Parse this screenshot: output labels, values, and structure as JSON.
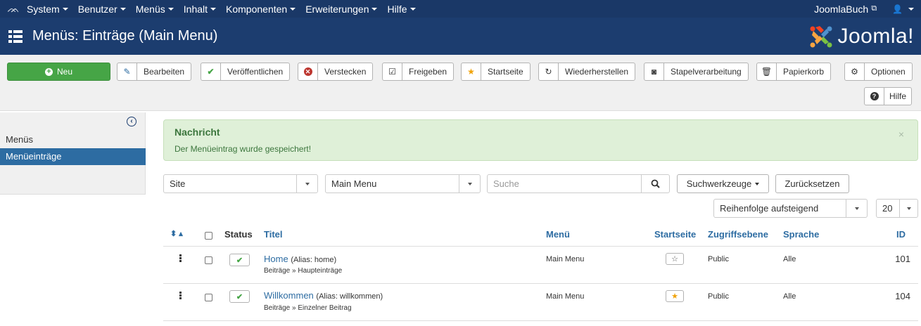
{
  "topnav": {
    "logo": "ᨏ",
    "menu": [
      {
        "label": "System"
      },
      {
        "label": "Benutzer"
      },
      {
        "label": "Menüs"
      },
      {
        "label": "Inhalt"
      },
      {
        "label": "Komponenten"
      },
      {
        "label": "Erweiterungen"
      },
      {
        "label": "Hilfe"
      }
    ],
    "site_link": "JoomlaBuch",
    "ext_icon": "⧉",
    "user_icon": "👤"
  },
  "header": {
    "title": "Menüs: Einträge (Main Menu)",
    "brand": "Joomla!"
  },
  "toolbar": {
    "new": "Neu",
    "edit": "Bearbeiten",
    "publish": "Veröffentlichen",
    "unpublish": "Verstecken",
    "checkin": "Freigeben",
    "home": "Startseite",
    "rebuild": "Wiederherstellen",
    "batch": "Stapelverarbeitung",
    "trash": "Papierkorb",
    "options": "Optionen",
    "help": "Hilfe"
  },
  "sidebar": {
    "items": [
      {
        "label": "Menüs"
      },
      {
        "label": "Menüeinträge"
      }
    ]
  },
  "alert": {
    "title": "Nachricht",
    "message": "Der Menüeintrag wurde gespeichert!",
    "close": "×"
  },
  "filters": {
    "client": "Site",
    "menu": "Main Menu",
    "search_placeholder": "Suche",
    "search_tools": "Suchwerkzeuge",
    "reset": "Zurücksetzen",
    "ordering": "Reihenfolge aufsteigend",
    "limit": "20"
  },
  "table": {
    "headers": {
      "status": "Status",
      "title": "Titel",
      "menu": "Menü",
      "home": "Startseite",
      "access": "Zugriffsebene",
      "language": "Sprache",
      "id": "ID"
    },
    "rows": [
      {
        "title": "Home",
        "alias": "(Alias: home)",
        "type": "Beiträge » Haupteinträge",
        "menu": "Main Menu",
        "home": "☆",
        "access": "Public",
        "language": "Alle",
        "id": "101"
      },
      {
        "title": "Willkommen",
        "alias": "(Alias: willkommen)",
        "type": "Beiträge » Einzelner Beitrag",
        "menu": "Main Menu",
        "home": "★",
        "access": "Public",
        "language": "Alle",
        "id": "104"
      }
    ]
  },
  "colors": {
    "topnav": "#1a3867",
    "header": "#1c3d6f",
    "accent": "#2d6ca2",
    "success": "#46a546",
    "star": "#f0a30a"
  }
}
